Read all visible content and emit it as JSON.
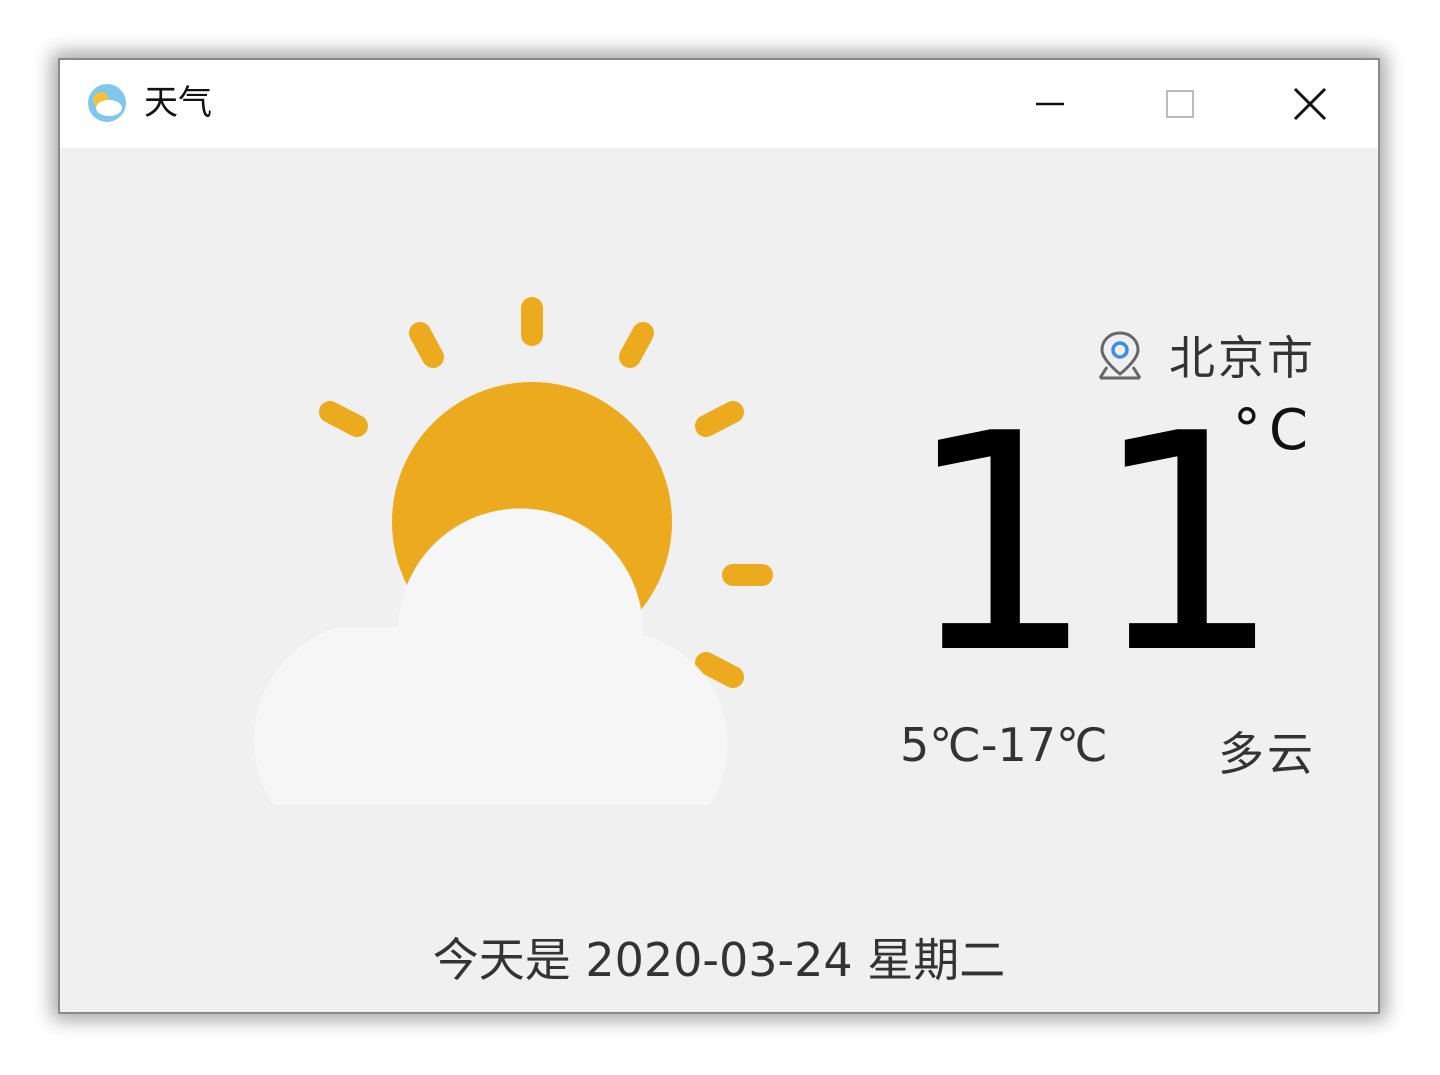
{
  "window": {
    "title": "天气",
    "icon": "weather-app-icon",
    "controls": {
      "minimize": "minimize-icon",
      "maximize": "maximize-icon",
      "close": "close-icon"
    }
  },
  "weather": {
    "icon": "partly-cloudy-icon",
    "location_icon": "location-pin-icon",
    "city": "北京市",
    "temperature": "11",
    "unit": "°C",
    "range": "5℃-17℃",
    "condition": "多云",
    "date_line": "今天是 2020-03-24 星期二"
  },
  "colors": {
    "sun": "#ecab1e",
    "cloud_front": "#f6f6f6",
    "cloud_back": "#e8e8e8",
    "background": "#f0f0f0",
    "pin_blue": "#3a8ee6"
  }
}
